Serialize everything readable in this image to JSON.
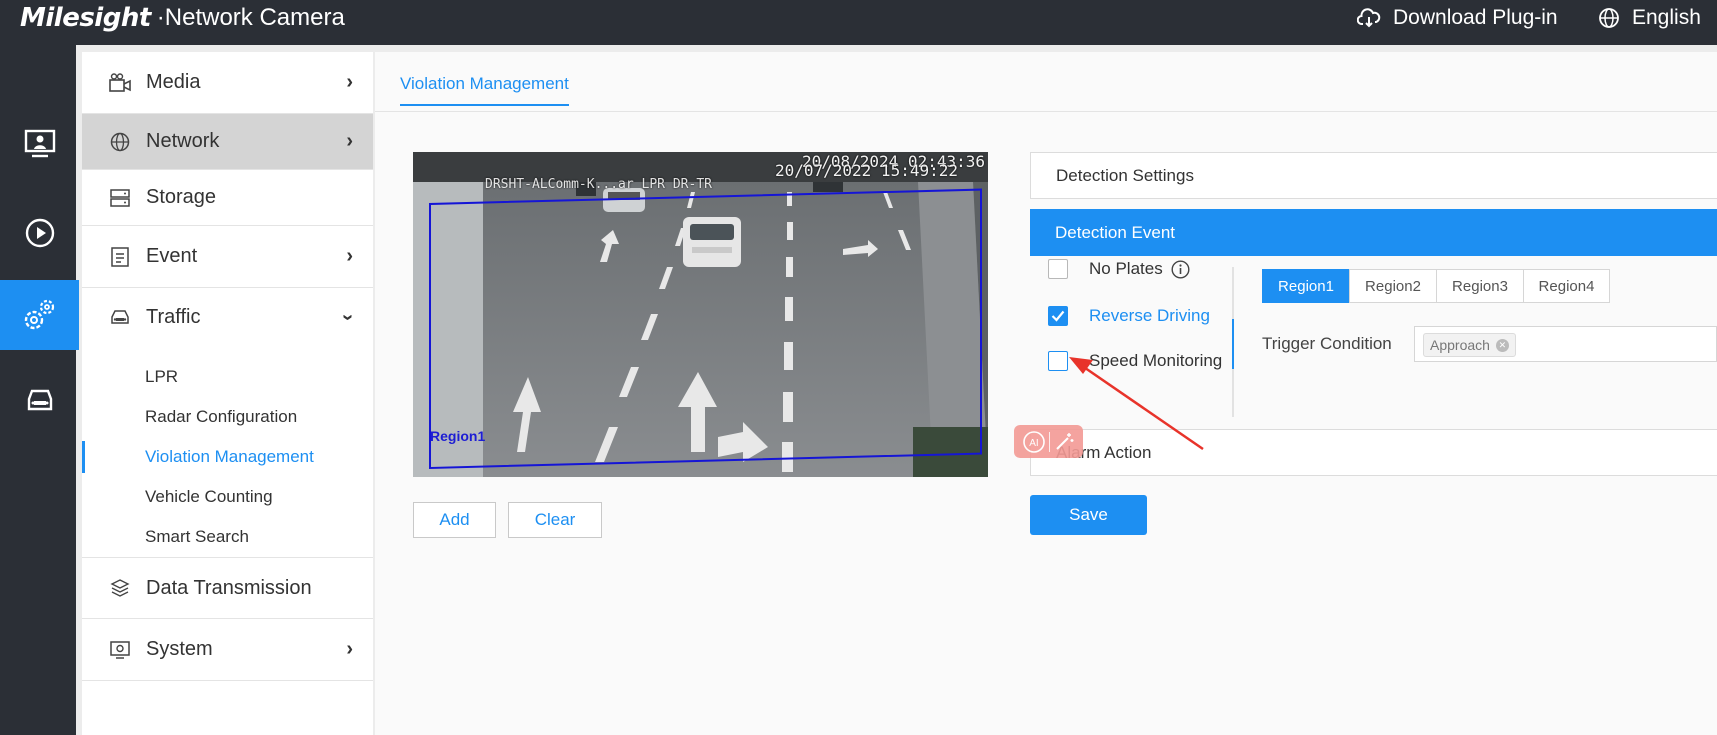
{
  "header": {
    "brand": "Milesight",
    "product": "·Network Camera",
    "plugin_label": "Download Plug-in",
    "language": "English"
  },
  "rail": [
    {
      "icon": "monitor-icon"
    },
    {
      "icon": "playback-icon"
    },
    {
      "icon": "settings-icon",
      "active": true
    },
    {
      "icon": "vehicle-icon"
    }
  ],
  "menu": {
    "media": "Media",
    "network": "Network",
    "storage": "Storage",
    "event": "Event",
    "traffic": "Traffic",
    "data_transmission": "Data Transmission",
    "system": "System",
    "traffic_sub": {
      "lpr": "LPR",
      "radar": "Radar Configuration",
      "violation": "Violation Management",
      "counting": "Vehicle Counting",
      "search": "Smart Search"
    }
  },
  "main": {
    "tab": "Violation Management",
    "preview": {
      "osd_date1": "20/08/2024 02:43:36",
      "osd_date2": "20/07/2022 15:49:22",
      "osd_camera": "DRSHT-ALComm-K...ar LPR DR-TR",
      "region_label": "Region1"
    },
    "add_label": "Add",
    "clear_label": "Clear"
  },
  "settings": {
    "detection_settings": "Detection Settings",
    "detection_event": "Detection Event",
    "alarm_action": "Alarm Action",
    "events": {
      "no_plates": "No Plates",
      "reverse_driving": "Reverse Driving",
      "speed_monitoring": "Speed Monitoring"
    },
    "regions": {
      "r1": "Region1",
      "r2": "Region2",
      "r3": "Region3",
      "r4": "Region4"
    },
    "trigger_label": "Trigger Condition",
    "trigger_tag": "Approach",
    "save_label": "Save"
  },
  "colors": {
    "accent": "#1d8ff2",
    "header_bg": "#2b2f36",
    "annotation_arrow": "#e8332a"
  }
}
